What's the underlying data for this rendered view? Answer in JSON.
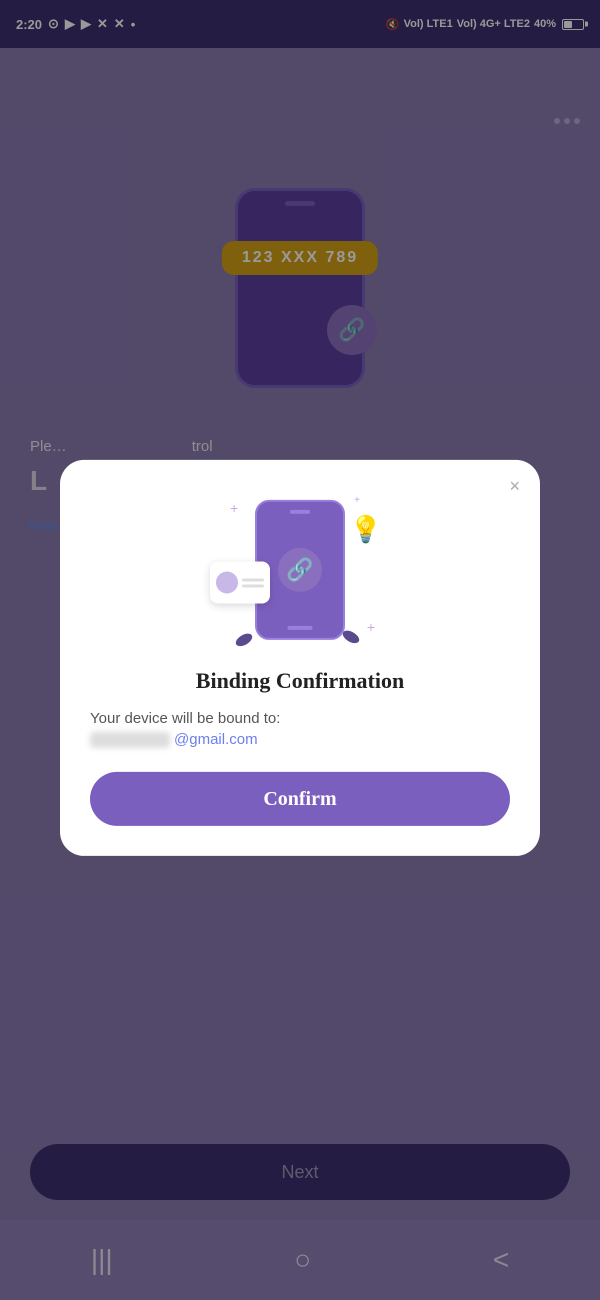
{
  "statusBar": {
    "time": "2:20",
    "battery": "40%"
  },
  "threeDots": "···",
  "background": {
    "phoneNumber": "123  XXX  789"
  },
  "nextButton": {
    "label": "Next"
  },
  "modal": {
    "closeIcon": "×",
    "title": "Binding Confirmation",
    "descText": "Your device will be bound to:",
    "emailSuffix": "@gmail.com",
    "confirmLabel": "Confirm",
    "chainSymbol": "🔗",
    "bulbSymbol": "💡"
  },
  "navBar": {
    "menuIcon": "|||",
    "homeIcon": "○",
    "backIcon": "<"
  }
}
